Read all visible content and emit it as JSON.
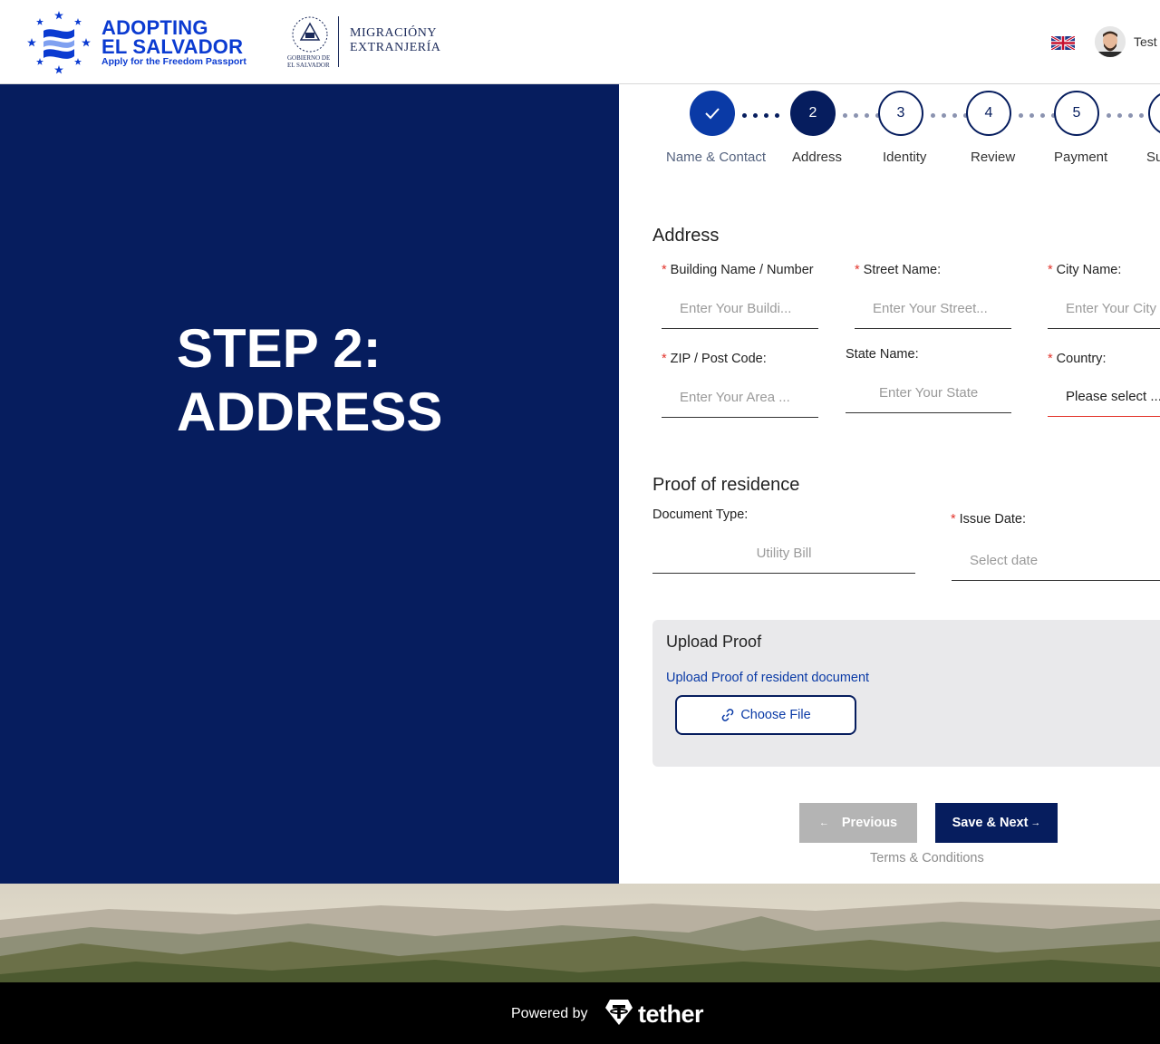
{
  "header": {
    "logo_line1": "ADOPTING",
    "logo_line2": "EL SALVADOR",
    "logo_tagline": "Apply for the Freedom Passport",
    "gov_small_line1": "GOBIERNO DE",
    "gov_small_line2": "EL SALVADOR",
    "gov_name_line1": "MIGRACIÓNY",
    "gov_name_line2": "EXTRANJERÍA",
    "language_icon": "uk-flag-icon",
    "user_name": "Test"
  },
  "hero": {
    "line1": "STEP 2:",
    "line2": "ADDRESS"
  },
  "stepper": {
    "steps": [
      {
        "number": "✓",
        "label": "Name & Contact",
        "state": "done"
      },
      {
        "number": "2",
        "label": "Address",
        "state": "active"
      },
      {
        "number": "3",
        "label": "Identity",
        "state": "todo"
      },
      {
        "number": "4",
        "label": "Review",
        "state": "todo"
      },
      {
        "number": "5",
        "label": "Payment",
        "state": "todo"
      },
      {
        "number": "",
        "label": "Su",
        "state": "todo"
      }
    ]
  },
  "address": {
    "title": "Address",
    "building": {
      "label": "Building Name / Number",
      "colon": ":",
      "placeholder": "Enter Your Buildi..."
    },
    "street": {
      "label": "Street Name",
      "colon": ":",
      "placeholder": "Enter Your Street..."
    },
    "city": {
      "label": "City Name",
      "colon": ":",
      "placeholder": "Enter Your City"
    },
    "zip": {
      "label": "ZIP / Post Code",
      "colon": ":",
      "placeholder": "Enter Your Area ..."
    },
    "state": {
      "label": "State Name",
      "colon": ":",
      "placeholder": "Enter Your State"
    },
    "country": {
      "label": "Country",
      "colon": ":",
      "value": "Please select ..."
    }
  },
  "proof": {
    "title": "Proof of residence",
    "doc_type": {
      "label": "Document Type",
      "colon": ":",
      "value": "Utility Bill"
    },
    "issue_date": {
      "label": "Issue Date",
      "colon": ":",
      "placeholder": "Select date"
    }
  },
  "upload": {
    "title": "Upload Proof",
    "link": "Upload Proof of resident document",
    "button": "Choose File"
  },
  "nav": {
    "prev": "Previous",
    "next": "Save & Next",
    "terms": "Terms & Conditions"
  },
  "footer": {
    "powered_by": "Powered by",
    "brand": "tether"
  },
  "colors": {
    "navy": "#061d5e",
    "brand_blue": "#0b3bd1",
    "link_blue": "#0a3aa6",
    "required_red": "#e2332b"
  }
}
